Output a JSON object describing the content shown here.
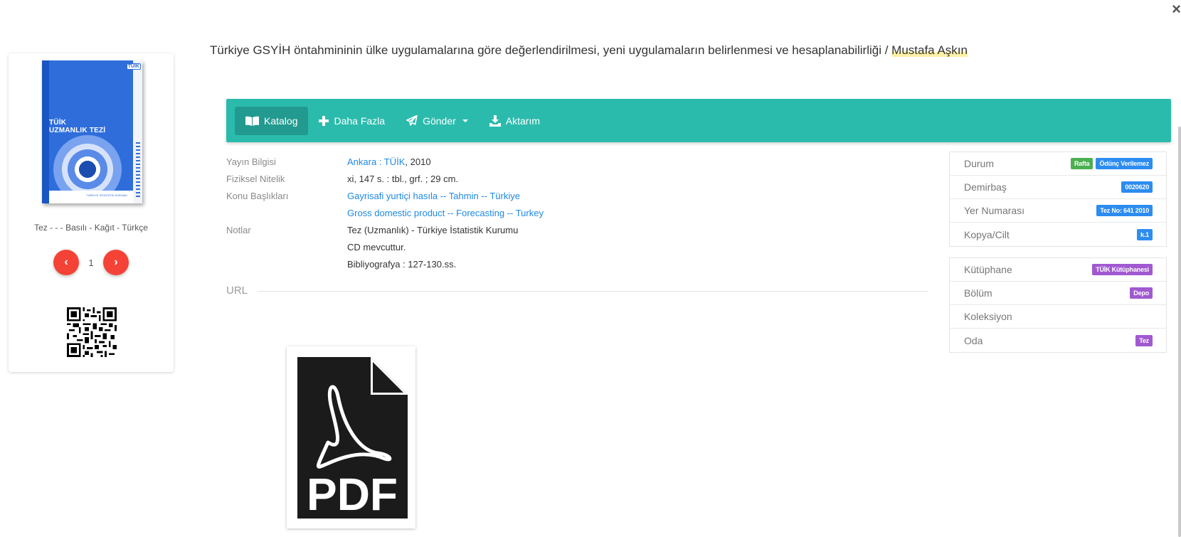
{
  "window": {
    "close_glyph": "×"
  },
  "record": {
    "title": "Türkiye GSYİH öntahmininin ülke uygulamalarına göre değerlendirilmesi, yeni uygulamaların belirlenmesi ve hesaplanabilirliği / ",
    "author_first": "Mustafa",
    "author_last": "Aşkın"
  },
  "cover": {
    "logo": "TÜİK",
    "title_line1": "TÜİK",
    "title_line2": "UZMANLIK TEZİ",
    "footer": "TÜRKİYE İSTATİSTİK KURUMU"
  },
  "left_card": {
    "meta": "Tez - - - Basılı - Kağıt - Türkçe",
    "page_number": "1",
    "prev_glyph": "‹",
    "next_glyph": "›"
  },
  "toolbar": {
    "items": [
      {
        "label": "Katalog",
        "icon": "book-icon",
        "active": true
      },
      {
        "label": "Daha Fazla",
        "icon": "plus-icon"
      },
      {
        "label": "Gönder",
        "icon": "paper-plane-icon",
        "dropdown": true
      },
      {
        "label": "Aktarım",
        "icon": "download-icon"
      }
    ]
  },
  "details": {
    "publication": {
      "label": "Yayın Bilgisi",
      "place_link": "Ankara : TÜİK",
      "year": ", 2010"
    },
    "physical": {
      "label": "Fiziksel Nitelik",
      "value": "xi, 147 s. : tbl., grf. ; 29 cm."
    },
    "subjects": {
      "label": "Konu Başlıkları",
      "items": [
        "Gayrisafi yurtiçi hasıla -- Tahmin -- Türkiye",
        "Gross domestic product -- Forecasting -- Turkey"
      ]
    },
    "notes": {
      "label": "Notlar",
      "items": [
        "Tez (Uzmanlık) - Türkiye İstatistik Kurumu",
        "CD mevcuttur.",
        "Bibliyografya : 127-130.ss."
      ]
    },
    "url_label": "URL"
  },
  "pdf": {
    "label": "PDF"
  },
  "holdings": {
    "status": {
      "label": "Durum",
      "badges": [
        "Rafta",
        "Ödünç Verilemez"
      ]
    },
    "barcode": {
      "label": "Demirbaş",
      "value": "0020620"
    },
    "call_number": {
      "label": "Yer Numarası",
      "value": "Tez No: 641 2010"
    },
    "copy": {
      "label": "Kopya/Cilt",
      "value": "k.1"
    }
  },
  "location": {
    "library": {
      "label": "Kütüphane",
      "value": "TÜİK Kütüphanesi"
    },
    "section": {
      "label": "Bölüm",
      "value": "Depo"
    },
    "collection": {
      "label": "Koleksiyon",
      "value": ""
    },
    "room": {
      "label": "Oda",
      "value": "Tez"
    }
  },
  "colors": {
    "toolbar": "#2bbbad",
    "link": "#1e88e5",
    "pager": "#f44336",
    "badge_green": "#4caf50",
    "badge_blue": "#2d8cf0",
    "badge_purple": "#a159d1"
  }
}
